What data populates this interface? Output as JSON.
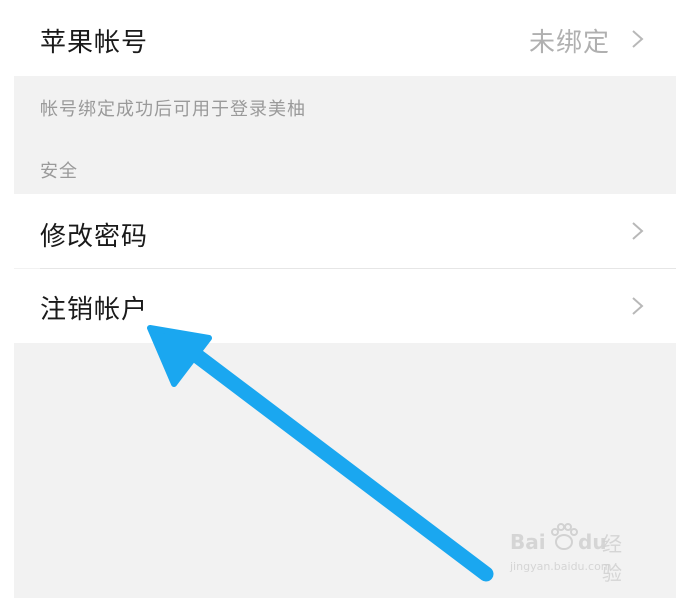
{
  "rows": {
    "apple": {
      "label": "苹果帐号",
      "value": "未绑定"
    },
    "change_password": {
      "label": "修改密码"
    },
    "cancel_account": {
      "label": "注销帐户"
    }
  },
  "hints": {
    "bind_hint": "帐号绑定成功后可用于登录美柚",
    "security_section": "安全"
  },
  "watermark": {
    "brand": "Bai",
    "brand_suffix": "du",
    "product": "经验",
    "url": "jingyan.baidu.com"
  },
  "colors": {
    "arrow": "#1aa7f0",
    "background_gray": "#f2f2f2",
    "label_text": "#1a1a1a",
    "muted_text": "#9a9a9a"
  },
  "icons": {
    "row_chevron": "chevron-right-icon",
    "annotation": "blue-arrow-annotation",
    "watermark_logo": "baidu-paw-icon"
  }
}
